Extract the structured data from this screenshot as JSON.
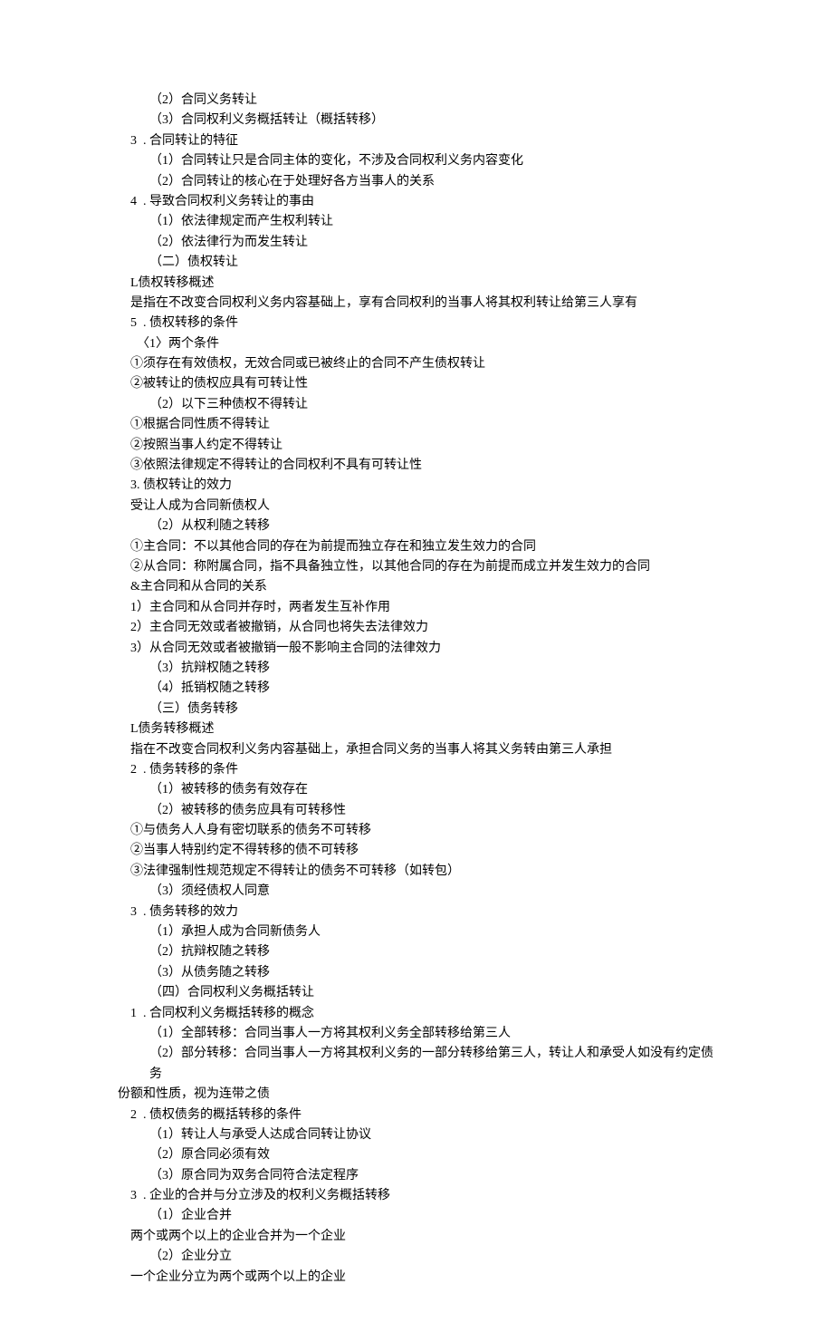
{
  "lines": [
    {
      "t": "（2）合同义务转让",
      "c": "i1"
    },
    {
      "t": "（3）合同权利义务概括转让（概括转移）",
      "c": "i1"
    },
    {
      "t": "3  . 合同转让的特征",
      "c": "i2"
    },
    {
      "t": "（1）合同转让只是合同主体的变化，不涉及合同权利义务内容变化",
      "c": "i1"
    },
    {
      "t": "（2）合同转让的核心在于处理好各方当事人的关系",
      "c": "i1"
    },
    {
      "t": "4  . 导致合同权利义务转让的事由",
      "c": "i2"
    },
    {
      "t": "（1）依法律规定而产生权利转让",
      "c": "i1"
    },
    {
      "t": "（2）依法律行为而发生转让",
      "c": "i1"
    },
    {
      "t": "（二）债权转让",
      "c": "i1"
    },
    {
      "t": "L债权转移概述",
      "c": "i2"
    },
    {
      "t": "是指在不改变合同权利义务内容基础上，享有合同权利的当事人将其权利转让给第三人享有",
      "c": "i2"
    },
    {
      "t": "5  . 债权转移的条件",
      "c": "i2"
    },
    {
      "t": "〈1〉两个条件",
      "c": "i4"
    },
    {
      "t": "①须存在有效债权，无效合同或已被终止的合同不产生债权转让",
      "c": "i2"
    },
    {
      "t": "②被转让的债权应具有可转让性",
      "c": "i2"
    },
    {
      "t": "（2）以下三种债权不得转让",
      "c": "i1"
    },
    {
      "t": "①根据合同性质不得转让",
      "c": "i2"
    },
    {
      "t": "②按照当事人约定不得转让",
      "c": "i2"
    },
    {
      "t": "③依照法律规定不得转让的合同权利不具有可转让性",
      "c": "i2"
    },
    {
      "t": "3. 债权转让的效力",
      "c": "i2"
    },
    {
      "t": "受让人成为合同新债权人",
      "c": "i2"
    },
    {
      "t": "（2）从权利随之转移",
      "c": "i1"
    },
    {
      "t": "①主合同：不以其他合同的存在为前提而独立存在和独立发生效力的合同",
      "c": "i2"
    },
    {
      "t": "②从合同：称附属合同，指不具备独立性，以其他合同的存在为前提而成立并发生效力的合同",
      "c": "i2"
    },
    {
      "t": "&主合同和从合同的关系",
      "c": "i2"
    },
    {
      "t": "1）主合同和从合同并存时，两者发生互补作用",
      "c": "i2"
    },
    {
      "t": "2）主合同无效或者被撤销，从合同也将失去法律效力",
      "c": "i2"
    },
    {
      "t": "3）从合同无效或者被撤销一般不影响主合同的法律效力",
      "c": "i2"
    },
    {
      "t": "（3）抗辩权随之转移",
      "c": "i1"
    },
    {
      "t": "（4）抵销权随之转移",
      "c": "i1"
    },
    {
      "t": "（三）债务转移",
      "c": "i1"
    },
    {
      "t": "L债务转移概述",
      "c": "i2"
    },
    {
      "t": "指在不改变合同权利义务内容基础上，承担合同义务的当事人将其义务转由第三人承担",
      "c": "i2"
    },
    {
      "t": "2  . 债务转移的条件",
      "c": "i2"
    },
    {
      "t": "（1）被转移的债务有效存在",
      "c": "i1"
    },
    {
      "t": "（2）被转移的债务应具有可转移性",
      "c": "i1"
    },
    {
      "t": "①与债务人人身有密切联系的债务不可转移",
      "c": "i2"
    },
    {
      "t": "②当事人特别约定不得转移的债不可转移",
      "c": "i2"
    },
    {
      "t": "③法律强制性规范规定不得转让的债务不可转移（如转包）",
      "c": "i2"
    },
    {
      "t": "（3）须经债权人同意",
      "c": "i1"
    },
    {
      "t": "3  . 债务转移的效力",
      "c": "i2"
    },
    {
      "t": "（1）承担人成为合同新债务人",
      "c": "i1"
    },
    {
      "t": "（2）抗辩权随之转移",
      "c": "i1"
    },
    {
      "t": "（3）从债务随之转移",
      "c": "i1"
    },
    {
      "t": "（四）合同权利义务概括转让",
      "c": "i1"
    },
    {
      "t": "1  . 合同权利义务概括转移的概念",
      "c": "i2"
    },
    {
      "t": "（1）全部转移：合同当事人一方将其权利义务全部转移给第三人",
      "c": "i1"
    },
    {
      "t": "（2）部分转移：合同当事人一方将其权利义务的一部分转移给第三人，转让人和承受人如没有约定债   务",
      "c": "i1"
    },
    {
      "t": "份额和性质，视为连带之债",
      "c": ""
    },
    {
      "t": "2  . 债权债务的概括转移的条件",
      "c": "i2"
    },
    {
      "t": "（1）转让人与承受人达成合同转让协议",
      "c": "i1"
    },
    {
      "t": "（2）原合同必须有效",
      "c": "i1"
    },
    {
      "t": "（3）原合同为双务合同符合法定程序",
      "c": "i1"
    },
    {
      "t": "3  . 企业的合并与分立涉及的权利义务概括转移",
      "c": "i2"
    },
    {
      "t": "（1）企业合并",
      "c": "i1"
    },
    {
      "t": "两个或两个以上的企业合并为一个企业",
      "c": "i2"
    },
    {
      "t": "（2）企业分立",
      "c": "i1"
    },
    {
      "t": "一个企业分立为两个或两个以上的企业",
      "c": "i2"
    }
  ]
}
